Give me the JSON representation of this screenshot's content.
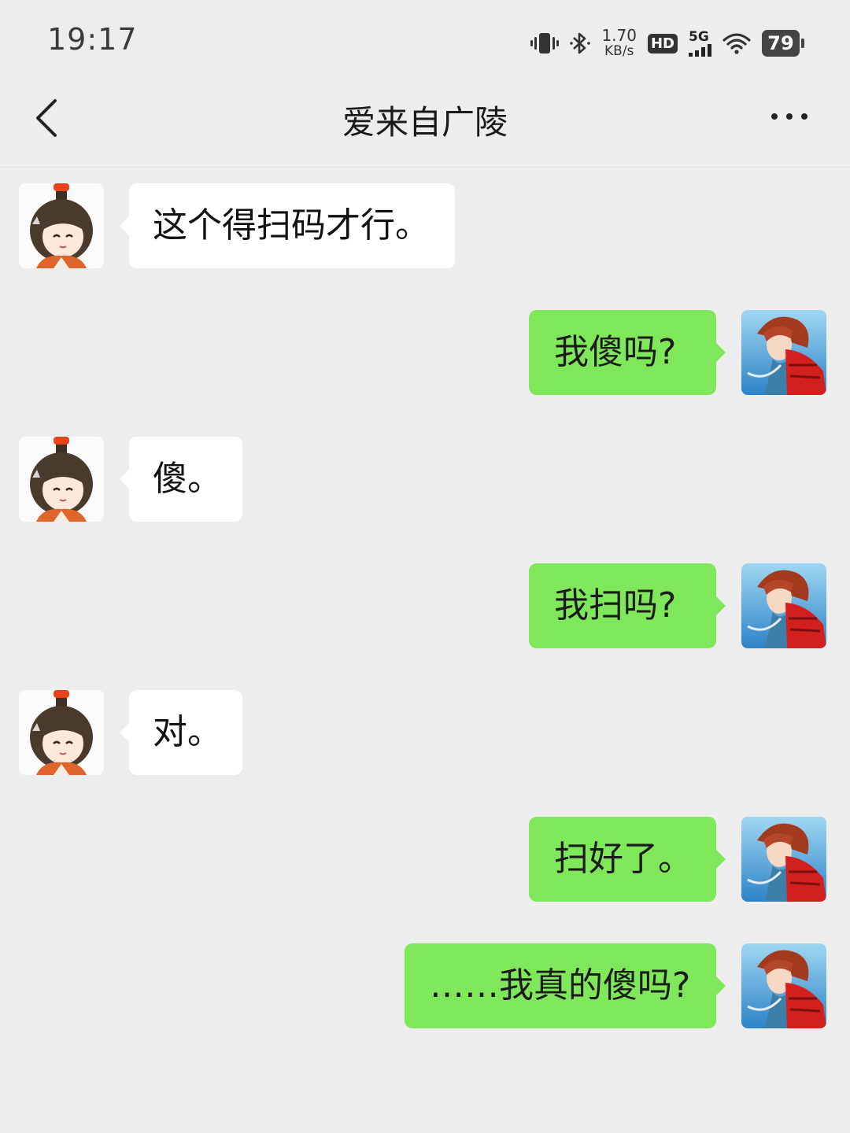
{
  "status_bar": {
    "time": "19:17",
    "net_speed_value": "1.70",
    "net_speed_unit": "KB/s",
    "hd_label": "HD",
    "signal_label": "5G",
    "battery": "79",
    "icons": [
      "vibrate-icon",
      "bluetooth-icon",
      "wifi-icon"
    ]
  },
  "header": {
    "title": "爱来自广陵",
    "back_icon": "chevron-left-icon",
    "more_icon": "more-dots-icon"
  },
  "messages": [
    {
      "side": "in",
      "text": "这个得扫码才行。"
    },
    {
      "side": "out",
      "text": "我傻吗?"
    },
    {
      "side": "in",
      "text": "傻。"
    },
    {
      "side": "out",
      "text": "我扫吗?"
    },
    {
      "side": "in",
      "text": "对。"
    },
    {
      "side": "out",
      "text": "扫好了。"
    },
    {
      "side": "out",
      "text": "……我真的傻吗?"
    }
  ],
  "colors": {
    "background": "#ededed",
    "outgoing_bubble": "#7fe85a",
    "incoming_bubble": "#ffffff"
  }
}
